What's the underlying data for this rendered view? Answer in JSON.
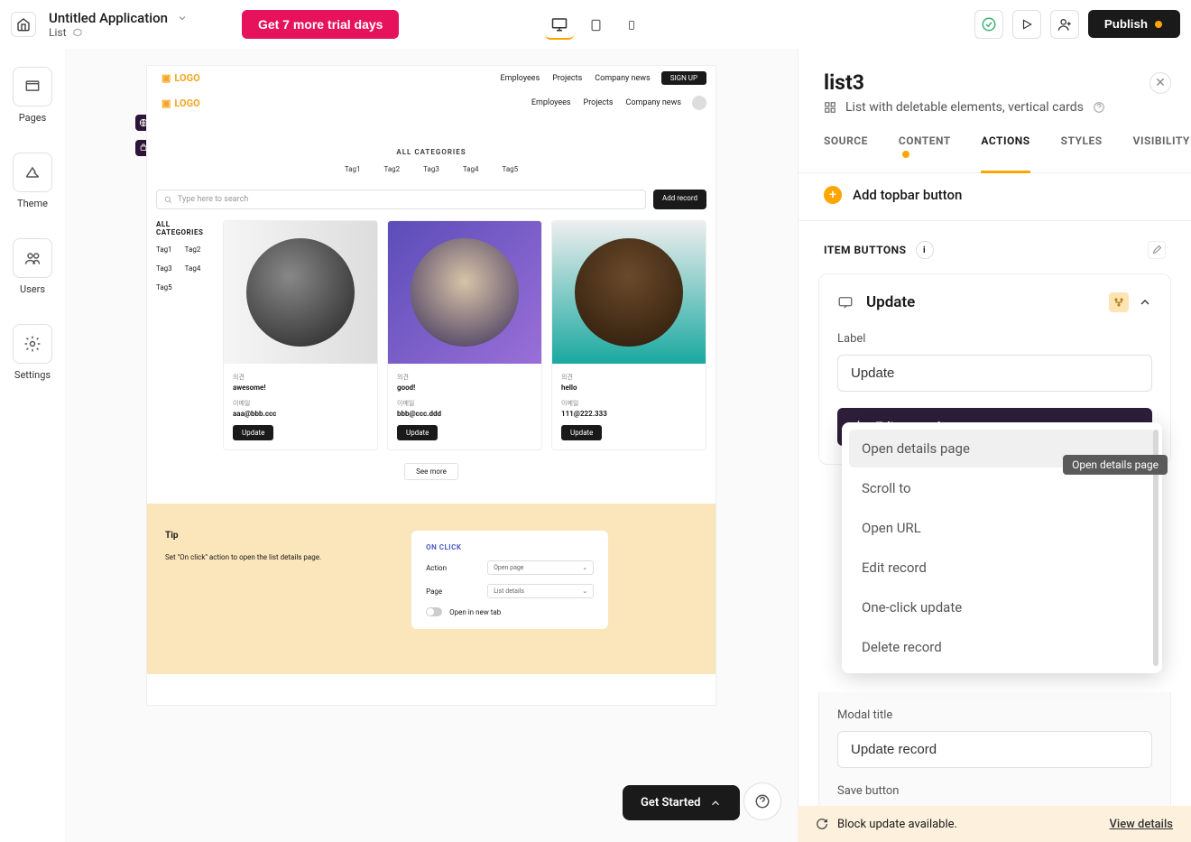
{
  "topbar": {
    "app_title": "Untitled Application",
    "page_label": "List",
    "trial_button": "Get 7 more trial days",
    "publish": "Publish"
  },
  "leftrail": {
    "pages": "Pages",
    "theme": "Theme",
    "users": "Users",
    "settings": "Settings"
  },
  "preview": {
    "logo": "LOGO",
    "nav": [
      "Employees",
      "Projects",
      "Company news"
    ],
    "signup": "SIGN UP",
    "all_categories": "ALL CATEGORIES",
    "tags": [
      "Tag1",
      "Tag2",
      "Tag3",
      "Tag4",
      "Tag5"
    ],
    "search_placeholder": "Type here to search",
    "add_record": "Add record",
    "side_tags_h": "ALL CATEGORIES",
    "cards": [
      {
        "l1": "의견",
        "v1": "awesome!",
        "l2": "이메일",
        "v2": "aaa@bbb.ccc",
        "btn": "Update"
      },
      {
        "l1": "의견",
        "v1": "good!",
        "l2": "이메일",
        "v2": "bbb@ccc.ddd",
        "btn": "Update"
      },
      {
        "l1": "의견",
        "v1": "hello",
        "l2": "이메일",
        "v2": "111@222.333",
        "btn": "Update"
      }
    ],
    "see_more": "See more",
    "tip_h": "Tip",
    "tip_t": "Set \"On click\" action to open the list details page.",
    "tip_card": {
      "h": "ON CLICK",
      "action_l": "Action",
      "action_v": "Open page",
      "page_l": "Page",
      "page_v": "List details",
      "newtab": "Open in new tab"
    }
  },
  "right": {
    "title": "list3",
    "sub": "List with deletable elements, vertical cards",
    "tabs": {
      "source": "SOURCE",
      "content": "CONTENT",
      "actions": "ACTIONS",
      "styles": "STYLES",
      "visibility": "VISIBILITY"
    },
    "add_topbar": "Add topbar button",
    "item_buttons": "ITEM BUTTONS",
    "update_h": "Update",
    "label_l": "Label",
    "label_v": "Update",
    "action_bar": "Edit record",
    "dropdown": [
      "Open details page",
      "Scroll to",
      "Open URL",
      "Edit record",
      "One-click update",
      "Delete record"
    ],
    "tooltip": "Open details page",
    "modal_title_l": "Modal title",
    "modal_title_v": "Update record",
    "save_button_l": "Save button"
  },
  "footer": {
    "msg": "Block update available.",
    "link": "View details"
  },
  "getstarted": "Get Started"
}
